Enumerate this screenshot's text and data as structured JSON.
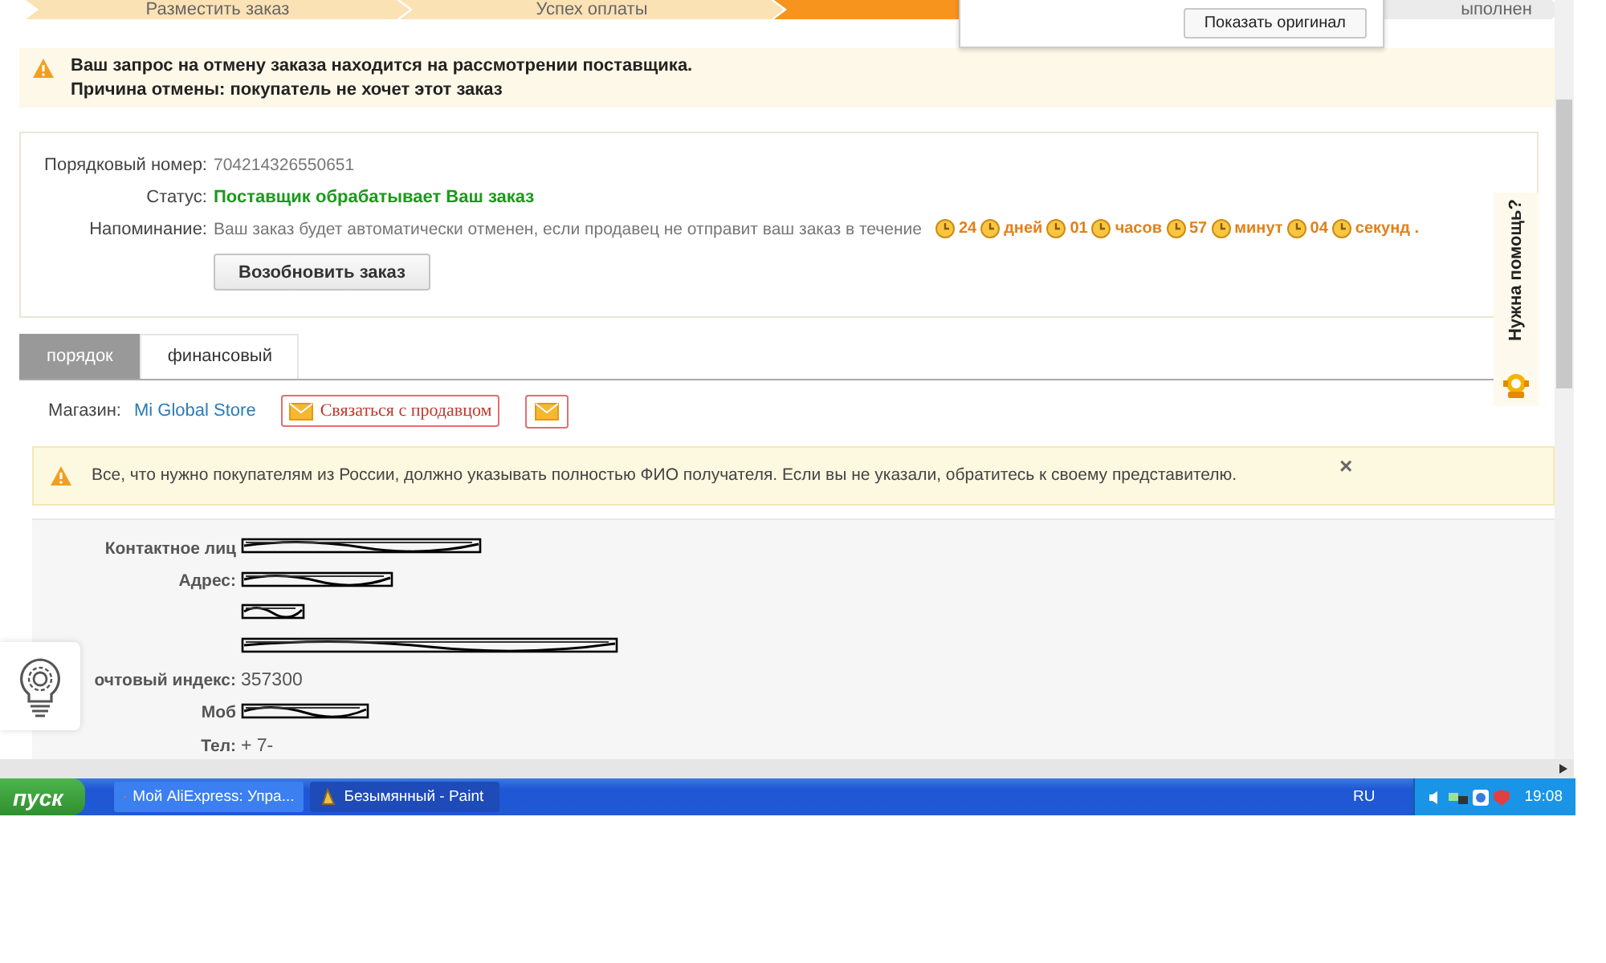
{
  "steps": [
    {
      "label": "Разместить заказ",
      "kind": "done"
    },
    {
      "label": "Успех оплаты",
      "kind": "done"
    },
    {
      "kind": "current"
    },
    {
      "label": "ыполнен",
      "kind": "todo"
    }
  ],
  "translate_popup": {
    "button": "Показать оригинал"
  },
  "cancel_notice": {
    "lines": [
      "Ваш запрос на отмену заказа находится на рассмотрении поставщика.",
      "Причина отмены: покупатель не хочет этот заказ"
    ]
  },
  "order_info": {
    "rows": [
      {
        "kind": "plain",
        "label": "Порядковый номер:",
        "value": "704214326550651"
      },
      {
        "kind": "status",
        "label": "Статус:",
        "value": "Поставщик обрабатывает Ваш заказ"
      },
      {
        "kind": "countdown",
        "label": "Напоминание:",
        "value": "Ваш заказ будет автоматически отменен, если продавец не отправит ваш заказ в течение",
        "timer": [
          {
            "value": "24",
            "unit": "дней"
          },
          {
            "value": "01",
            "unit": "часов"
          },
          {
            "value": "57",
            "unit": "минут"
          },
          {
            "value": "04",
            "unit": "секунд ."
          }
        ]
      }
    ],
    "button": "Возобновить заказ"
  },
  "help_tab": {
    "label": "Нужна помощь?"
  },
  "tabs": [
    {
      "label": "порядок",
      "selected": true
    },
    {
      "label": "финансовый",
      "selected": false
    }
  ],
  "shop": {
    "label": "Магазин:",
    "name": "Mi Global Store",
    "contact_button": "Связаться с продавцом"
  },
  "buyer_notice": {
    "text": "Все, что нужно покупателям из России, должно указывать полностью ФИО получателя. Если вы не указали, обратитесь к своему представителю.",
    "close": "×"
  },
  "contact": [
    {
      "label": "Контактное лиц",
      "redacted": true
    },
    {
      "label": "Адрес:",
      "redacted": true
    },
    {
      "redacted": true
    },
    {
      "redacted": true
    },
    {
      "label": "очтовый индекс:",
      "value": "357300",
      "redacted": false
    },
    {
      "label": "Моб",
      "redacted": true
    },
    {
      "label": "Тел:",
      "value": "+ 7-",
      "redacted": false
    }
  ],
  "taskbar": {
    "start": "пуск",
    "tasks": [
      {
        "label": "Мой AliExpress: Упра...",
        "selected": false
      },
      {
        "label": "Безымянный - Paint",
        "selected": true
      }
    ],
    "language": "RU",
    "clock": "19:08"
  }
}
